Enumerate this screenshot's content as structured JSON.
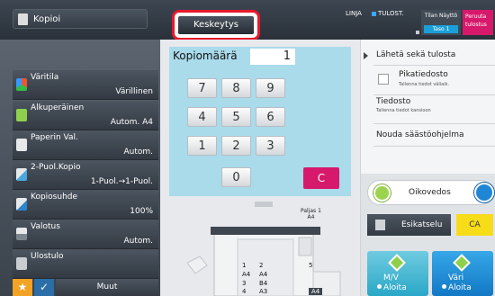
{
  "topbar": {
    "mode_label": "Kopioi",
    "interrupt_label": "Keskeytys",
    "status_line": "LINJA",
    "status_print": "TULOST.",
    "status_display": "Tilan Näyttö",
    "level": "Taso 1",
    "cancel_line1": "Peruuta",
    "cancel_line2": "tulostus"
  },
  "left_panel": {
    "items": [
      {
        "title": "Väritila",
        "value": "Värillinen"
      },
      {
        "title": "Alkuperäinen",
        "value": "Autom.  A4"
      },
      {
        "title": "Paperin Val.",
        "value": "Autom."
      },
      {
        "title": "2-Puol.Kopio",
        "value": "1-Puol.→1-Puol."
      },
      {
        "title": "Kopiosuhde",
        "value": "100%"
      },
      {
        "title": "Valotus",
        "value": "Autom."
      },
      {
        "title": "Ulostulo",
        "value": ""
      }
    ],
    "more_label": "Muut",
    "star_glyph": "★",
    "check_glyph": "✓"
  },
  "keypad": {
    "count_label": "Kopiomäärä",
    "count_value": "1",
    "keys": [
      "7",
      "8",
      "9",
      "4",
      "5",
      "6",
      "1",
      "2",
      "3",
      "0"
    ],
    "clear_label": "C"
  },
  "machine": {
    "bypass_label": "Paljas 1",
    "bypass_size": "A4",
    "trays": [
      {
        "num": "1",
        "size": "A4"
      },
      {
        "num": "2",
        "size": "A4"
      },
      {
        "num": "3",
        "size": "B4"
      },
      {
        "num": "4",
        "size": "A3"
      },
      {
        "num": "5",
        "size": ""
      }
    ],
    "output_size": "A4"
  },
  "right_panel": {
    "send_and_print": "Lähetä sekä tulosta",
    "quick_file_title": "Pikatiedosto",
    "quick_file_desc": "Tallenna tiedot väliaik.",
    "file_title": "Tiedosto",
    "file_desc": "Tallenna tiedot kansioon",
    "recall_program": "Nouda säästöohjelma",
    "proof_label": "Oikovedos",
    "preview_label": "Esikatselu",
    "ca_label": "CA",
    "start_bw_line1": "M/V",
    "start_bw_line2": "Aloita",
    "start_color_line1": "Väri",
    "start_color_line2": "Aloita"
  },
  "colors": {
    "interrupt_highlight": "#e8192c",
    "cancel_print": "#d7196b",
    "clear_key": "#d7196b",
    "level_badge": "#1a9fd9",
    "ca_button": "#f6dc19",
    "star_button": "#f2a224"
  }
}
